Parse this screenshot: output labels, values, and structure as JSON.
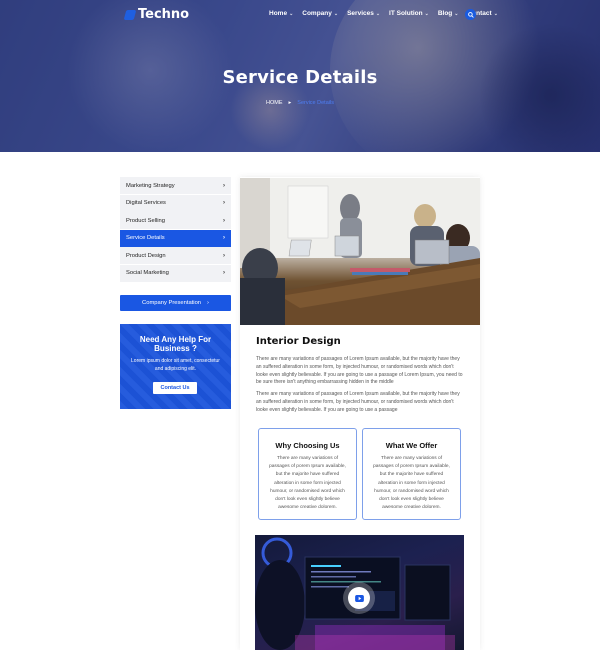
{
  "header": {
    "logo": "Techno",
    "nav": [
      {
        "label": "Home",
        "dropdown": true
      },
      {
        "label": "Company",
        "dropdown": true
      },
      {
        "label": "Services",
        "dropdown": true
      },
      {
        "label": "IT Solution",
        "dropdown": true
      },
      {
        "label": "Blog",
        "dropdown": true
      },
      {
        "label": "Contact",
        "dropdown": true
      }
    ],
    "search_icon": "search-icon"
  },
  "hero": {
    "title": "Service Details",
    "breadcrumb": {
      "home": "HOME",
      "current": "Service Details"
    }
  },
  "sidebar": {
    "items": [
      {
        "label": "Marketing Strategy",
        "active": false
      },
      {
        "label": "Digital Services",
        "active": false
      },
      {
        "label": "Product Selling",
        "active": false
      },
      {
        "label": "Service Details",
        "active": true
      },
      {
        "label": "Product Design",
        "active": false
      },
      {
        "label": "Social Marketing",
        "active": false
      }
    ],
    "presentation_button": "Company Presentation",
    "help": {
      "title_line1": "Need Any Help For",
      "title_line2": "Business ?",
      "text": "Lorem ipsum dolor sit amet, consectetur and adipiscing elit.",
      "button": "Contact Us"
    }
  },
  "main": {
    "title": "Interior Design",
    "paragraph1": "There are many variations of passages of Lorem Ipsum available, but the majority have they an suffered alteration in some form, by injected humour, or randomised words which don't looke even slightly believable. If you are going to use a passage of Lorem Ipsum, you need to be sure there isn't anything embarrassing hidden in the middle",
    "paragraph2": "There are many variations of passages of Lorem Ipsum available, but the majority have they an suffered alteration in some form, by injected humour, or randomised words which don't looke even slightly believable. If you are going to use a passage",
    "cards": [
      {
        "title": "Why Choosing Us",
        "text": "There are many variations of passages of porem Ipsum available, but the majorite have suffered alteration in some form injected humour, or randomised word which don't look even slightly believe awesome creative dolorem."
      },
      {
        "title": "What We Offer",
        "text": "There are many variations of passages of porem Ipsum available, but the majorite have suffered alteration in some form injected humour, or randomised word which don't look even slightly believe awesome creative dolorem."
      }
    ]
  },
  "colors": {
    "primary": "#1a57e3",
    "hero_overlay": "#3b4a87"
  }
}
